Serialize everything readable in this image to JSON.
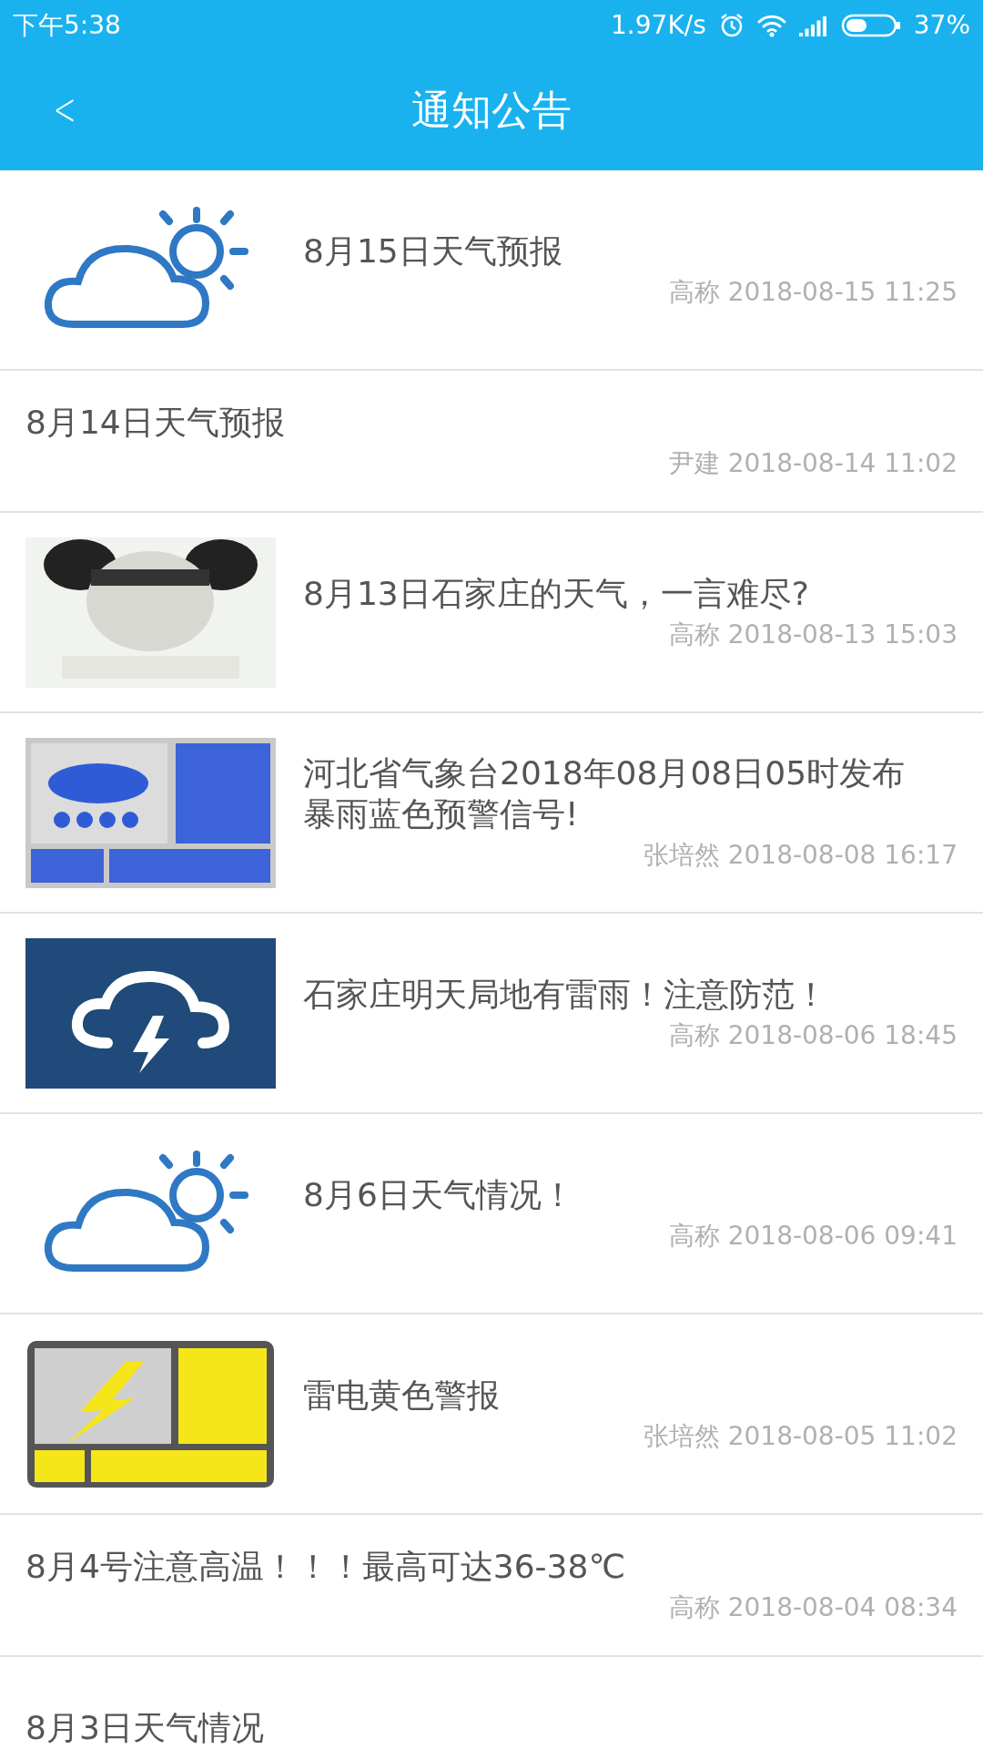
{
  "status_bar": {
    "time": "下午5:38",
    "speed": "1.97K/s",
    "battery": "37%"
  },
  "header": {
    "back": "<",
    "title": "通知公告"
  },
  "notices": [
    {
      "kind": "cloud-sun",
      "title": "8月15日天气预报",
      "meta": "高称 2018-08-15 11:25"
    },
    {
      "title": "8月14日天气预报",
      "meta": "尹建 2018-08-14 11:02"
    },
    {
      "kind": "picture",
      "title": "8月13日石家庄的天气，一言难尽?",
      "meta": "高称 2018-08-13 15:03"
    },
    {
      "kind": "storm-sign",
      "title": "河北省气象台2018年08月08日05时发布暴雨蓝色预警信号!",
      "meta": "张培然 2018-08-08 16:17"
    },
    {
      "kind": "thunder-cloud",
      "title": "石家庄明天局地有雷雨！注意防范！",
      "meta": "高称 2018-08-06 18:45"
    },
    {
      "kind": "cloud-sun",
      "title": "8月6日天气情况！",
      "meta": "高称 2018-08-06 09:41"
    },
    {
      "kind": "lightning-sign",
      "title": "雷电黄色警报",
      "meta": "张培然 2018-08-05 11:02"
    },
    {
      "title": "8月4号注意高温！！！最高可达36-38℃",
      "meta": "高称 2018-08-04 08:34"
    },
    {
      "title": "8月3日天气情况"
    }
  ]
}
